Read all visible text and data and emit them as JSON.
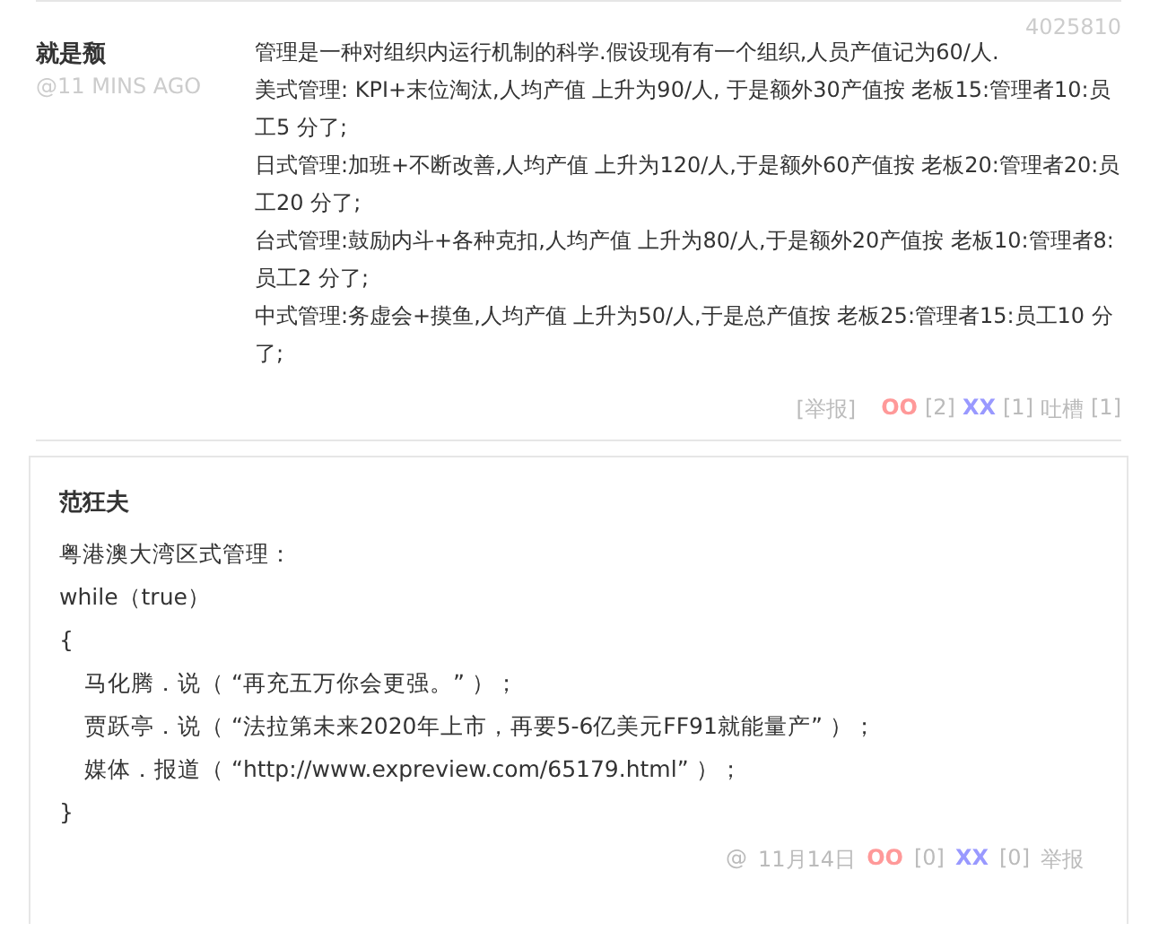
{
  "comment": {
    "number": "4025810",
    "author": "就是颓",
    "time": "@11 MINS AGO",
    "paragraphs": [
      "管理是一种对组织内运行机制的科学.假设现有有一个组织,人员产值记为60/人.",
      "美式管理: KPI+末位淘汰,人均产值 上升为90/人, 于是额外30产值按 老板15:管理者10:员工5 分了;",
      "日式管理:加班+不断改善,人均产值 上升为120/人,于是额外60产值按 老板20:管理者20:员工20 分了;",
      "台式管理:鼓励内斗+各种克扣,人均产值 上升为80/人,于是额外20产值按 老板10:管理者8:员工2 分了;",
      "中式管理:务虚会+摸鱼,人均产值 上升为50/人,于是总产值按 老板25:管理者15:员工10 分了;"
    ],
    "footer": {
      "report": "[举报]",
      "oo": "OO",
      "oo_count": "[2]",
      "xx": "XX",
      "xx_count": "[1]",
      "tucao": "吐槽",
      "tucao_count": "[1]"
    }
  },
  "reply": {
    "author": "范狂夫",
    "lines": [
      {
        "text": "粤港澳大湾区式管理：",
        "indent": false
      },
      {
        "text": "while（true）",
        "indent": false
      },
      {
        "text": "{",
        "indent": false
      },
      {
        "text": "马化腾．说（ “再充五万你会更强。” ）；",
        "indent": true
      },
      {
        "text": "贾跃亭．说（ “法拉第未来2020年上市，再要5-6亿美元FF91就能量产” ）；",
        "indent": true
      },
      {
        "text": "媒体．报道（ “http://www.expreview.com/65179.html” ）；",
        "indent": true
      },
      {
        "text": "}",
        "indent": false
      }
    ],
    "footer": {
      "at": "@",
      "date": "11月14日",
      "oo": "OO",
      "oo_count": "[0]",
      "xx": "XX",
      "xx_count": "[0]",
      "report": "举报"
    }
  }
}
